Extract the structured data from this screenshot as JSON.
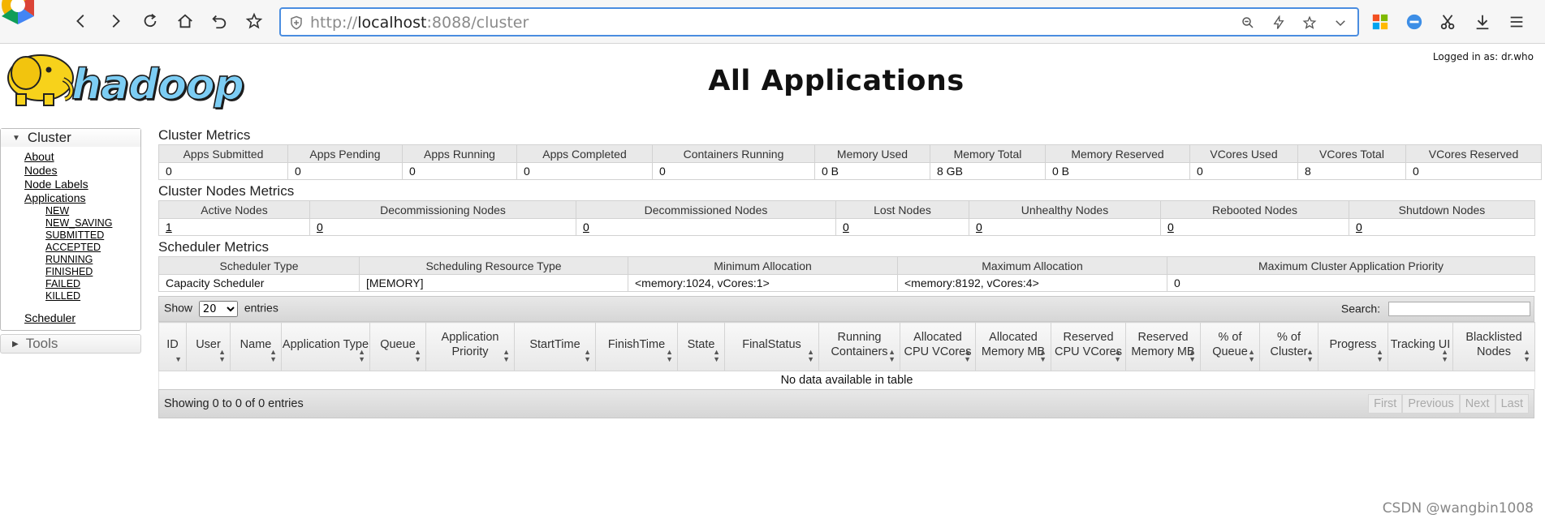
{
  "browser": {
    "url_scheme": "http://",
    "url_host": "localhost",
    "url_rest": ":8088/cluster"
  },
  "header": {
    "logged_in": "Logged in as: dr.who",
    "title": "All Applications",
    "logo_text": "hadoop"
  },
  "sidebar": {
    "cluster_label": "Cluster",
    "links": [
      "About",
      "Nodes",
      "Node Labels",
      "Applications"
    ],
    "app_states": [
      "NEW",
      "NEW_SAVING",
      "SUBMITTED",
      "ACCEPTED",
      "RUNNING",
      "FINISHED",
      "FAILED",
      "KILLED"
    ],
    "scheduler_label": "Scheduler",
    "tools_label": "Tools"
  },
  "cluster_metrics": {
    "title": "Cluster Metrics",
    "headers": [
      "Apps Submitted",
      "Apps Pending",
      "Apps Running",
      "Apps Completed",
      "Containers Running",
      "Memory Used",
      "Memory Total",
      "Memory Reserved",
      "VCores Used",
      "VCores Total",
      "VCores Reserved"
    ],
    "values": [
      "0",
      "0",
      "0",
      "0",
      "0",
      "0 B",
      "8 GB",
      "0 B",
      "0",
      "8",
      "0"
    ]
  },
  "node_metrics": {
    "title": "Cluster Nodes Metrics",
    "headers": [
      "Active Nodes",
      "Decommissioning Nodes",
      "Decommissioned Nodes",
      "Lost Nodes",
      "Unhealthy Nodes",
      "Rebooted Nodes",
      "Shutdown Nodes"
    ],
    "values": [
      "1",
      "0",
      "0",
      "0",
      "0",
      "0",
      "0"
    ]
  },
  "scheduler_metrics": {
    "title": "Scheduler Metrics",
    "headers": [
      "Scheduler Type",
      "Scheduling Resource Type",
      "Minimum Allocation",
      "Maximum Allocation",
      "Maximum Cluster Application Priority"
    ],
    "values": [
      "Capacity Scheduler",
      "[MEMORY]",
      "<memory:1024, vCores:1>",
      "<memory:8192, vCores:4>",
      "0"
    ]
  },
  "apps_table": {
    "show_label": "Show",
    "entries_label": "entries",
    "page_size": "20",
    "search_label": "Search:",
    "headers": [
      "ID",
      "User",
      "Name",
      "Application Type",
      "Queue",
      "Application Priority",
      "StartTime",
      "FinishTime",
      "State",
      "FinalStatus",
      "Running Containers",
      "Allocated CPU VCores",
      "Allocated Memory MB",
      "Reserved CPU VCores",
      "Reserved Memory MB",
      "% of Queue",
      "% of Cluster",
      "Progress",
      "Tracking UI",
      "Blacklisted Nodes"
    ],
    "empty_text": "No data available in table",
    "showing_text": "Showing 0 to 0 of 0 entries",
    "pager": [
      "First",
      "Previous",
      "Next",
      "Last"
    ]
  },
  "watermark": "CSDN @wangbin1008"
}
